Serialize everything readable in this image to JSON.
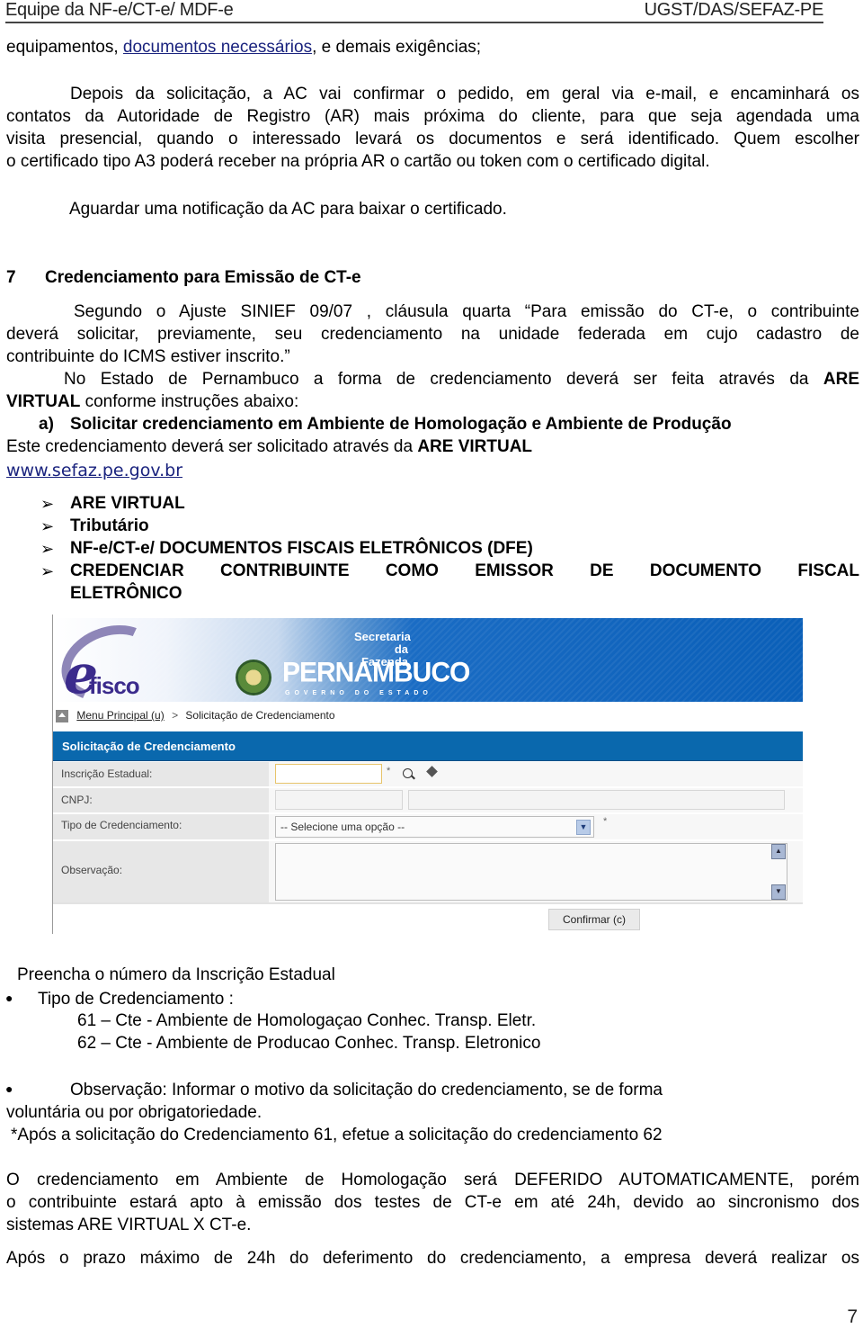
{
  "header": {
    "left": "Equipe da NF-e/CT-e/ MDF-e",
    "right": "UGST/DAS/SEFAZ-PE"
  },
  "intro": {
    "pre": "equipamentos, ",
    "link": "documentos necessários",
    "post": ", e demais exigências;"
  },
  "para1": [
    "Depois da solicitação, a AC vai confirmar o pedido, em geral via e-mail, e encaminhará os",
    "contatos da Autoridade de Registro (AR) mais próxima do cliente, para que seja agendada uma",
    "visita presencial, quando o interessado levará os documentos e será identificado. Quem escolher",
    "o certificado tipo A3 poderá receber na própria AR o cartão ou token com o certificado digital."
  ],
  "para2": "Aguardar uma notificação da AC para baixar o certificado.",
  "section": {
    "number": "7",
    "title": "Credenciamento para Emissão de CT-e"
  },
  "para3": [
    "Segundo o Ajuste SINIEF 09/07 , cláusula quarta “Para emissão do CT-e, o contribuinte",
    "deverá solicitar, previamente, seu credenciamento na unidade federada em cujo cadastro de",
    "contribuinte do ICMS estiver inscrito.”"
  ],
  "para4": {
    "line1_text": "No Estado de Pernambuco a forma de credenciamento deverá ser feita através da",
    "line1_bold": "ARE",
    "line2_bold": "VIRTUAL",
    "line2_text": " conforme instruções abaixo:"
  },
  "subheading": {
    "marker": "a)",
    "text": "Solicitar credenciamento em Ambiente de Homologação e Ambiente de Produção"
  },
  "para5": {
    "text": "Este credenciamento deverá ser solicitado através da ",
    "bold": "ARE VIRTUAL"
  },
  "website_link": "www.sefaz.pe.gov.br",
  "nav_steps": [
    "ARE VIRTUAL",
    "Tributário",
    "NF-e/CT-e/ DOCUMENTOS FISCAIS ELETRÔNICOS (DFE)",
    "CREDENCIAR CONTRIBUINTE COMO EMISSOR DE DOCUMENTO FISCAL",
    "ELETRÔNICO"
  ],
  "screenshot": {
    "logo_text": "fisco",
    "banner_secretaria": "Secretaria",
    "banner_fazenda": "da Fazenda",
    "banner_state": "PERNAMBUCO",
    "banner_gov": "GOVERNO DO ESTADO",
    "breadcrumb": {
      "home": "Menu Principal (u)",
      "separator": ">",
      "current": "Solicitação de Credenciamento"
    },
    "form_title": "Solicitação de Credenciamento",
    "fields": {
      "inscricao_label": "Inscrição Estadual:",
      "inscricao_value": "",
      "cnpj_label": "CNPJ:",
      "tipo_label": "Tipo de Credenciamento:",
      "tipo_selected": "-- Selecione uma opção --",
      "obs_label": "Observação:",
      "obs_value": "",
      "required_mark": "*"
    },
    "confirm_button": "Confirmar (c)",
    "colors": {
      "header_blue": "#0a68ad",
      "banner_blue": "#0a5fb8",
      "field_highlight": "#e7c46b"
    }
  },
  "instructions": {
    "fill": "Preencha o número da Inscrição Estadual",
    "tipo_label": "Tipo de Credenciamento :",
    "tipo_options": [
      "61 – Cte - Ambiente de Homologaçao  Conhec. Transp. Eletr.",
      "62 – Cte - Ambiente de Producao  Conhec. Transp. Eletronico"
    ],
    "obs_line1": "Observação: Informar o motivo da solicitação do credenciamento, se de forma",
    "obs_line2": "voluntária ou por obrigatoriedade.",
    "note": "*Após a solicitação do Credenciamento 61, efetue a solicitação do credenciamento 62"
  },
  "para6": [
    "O credenciamento em Ambiente de Homologação será DEFERIDO AUTOMATICAMENTE, porém",
    "o contribuinte estará apto à emissão dos testes de CT-e em até 24h, devido ao sincronismo dos",
    "sistemas ARE VIRTUAL X CT-e."
  ],
  "para7": "Após o prazo máximo de 24h do deferimento do credenciamento, a empresa deverá realizar os",
  "page_number": "7"
}
